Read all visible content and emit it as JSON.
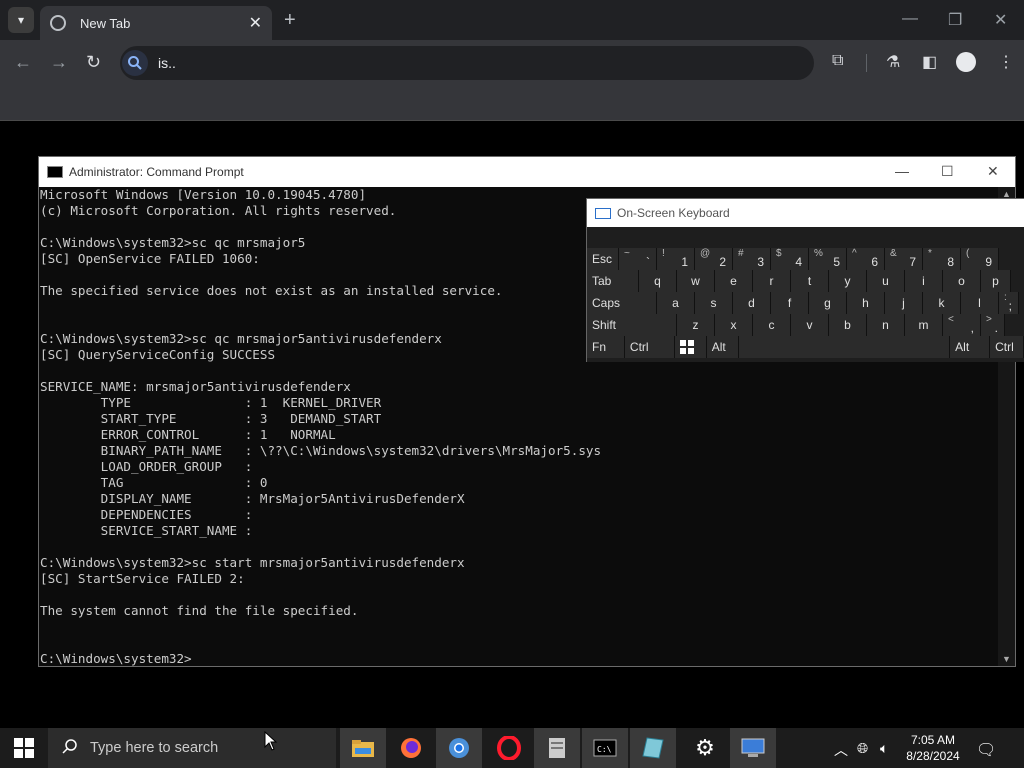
{
  "browser": {
    "tab_title": "New Tab",
    "omnibox_text": "is.."
  },
  "cmd": {
    "title": "Administrator: Command Prompt",
    "lines": [
      "Microsoft Windows [Version 10.0.19045.4780]",
      "(c) Microsoft Corporation. All rights reserved.",
      "",
      "C:\\Windows\\system32>sc qc mrsmajor5",
      "[SC] OpenService FAILED 1060:",
      "",
      "The specified service does not exist as an installed service.",
      "",
      "",
      "C:\\Windows\\system32>sc qc mrsmajor5antivirusdefenderx",
      "[SC] QueryServiceConfig SUCCESS",
      "",
      "SERVICE_NAME: mrsmajor5antivirusdefenderx",
      "        TYPE               : 1  KERNEL_DRIVER",
      "        START_TYPE         : 3   DEMAND_START",
      "        ERROR_CONTROL      : 1   NORMAL",
      "        BINARY_PATH_NAME   : \\??\\C:\\Windows\\system32\\drivers\\MrsMajor5.sys",
      "        LOAD_ORDER_GROUP   :",
      "        TAG                : 0",
      "        DISPLAY_NAME       : MrsMajor5AntivirusDefenderX",
      "        DEPENDENCIES       :",
      "        SERVICE_START_NAME :",
      "",
      "C:\\Windows\\system32>sc start mrsmajor5antivirusdefenderx",
      "[SC] StartService FAILED 2:",
      "",
      "The system cannot find the file specified.",
      "",
      "",
      "C:\\Windows\\system32>"
    ]
  },
  "osk": {
    "title": "On-Screen Keyboard",
    "rows": [
      [
        {
          "label": "Esc",
          "w": 32
        },
        {
          "shift": "~",
          "label": "`",
          "w": 38
        },
        {
          "shift": "!",
          "label": "1",
          "w": 38
        },
        {
          "shift": "@",
          "label": "2",
          "w": 38
        },
        {
          "shift": "#",
          "label": "3",
          "w": 38
        },
        {
          "shift": "$",
          "label": "4",
          "w": 38
        },
        {
          "shift": "%",
          "label": "5",
          "w": 38
        },
        {
          "shift": "^",
          "label": "6",
          "w": 38
        },
        {
          "shift": "&",
          "label": "7",
          "w": 38
        },
        {
          "shift": "*",
          "label": "8",
          "w": 38
        },
        {
          "shift": "(",
          "label": "9",
          "w": 38
        }
      ],
      [
        {
          "label": "Tab",
          "w": 52
        },
        {
          "label": "q",
          "w": 38
        },
        {
          "label": "w",
          "w": 38
        },
        {
          "label": "e",
          "w": 38
        },
        {
          "label": "r",
          "w": 38
        },
        {
          "label": "t",
          "w": 38
        },
        {
          "label": "y",
          "w": 38
        },
        {
          "label": "u",
          "w": 38
        },
        {
          "label": "i",
          "w": 38
        },
        {
          "label": "o",
          "w": 38
        },
        {
          "label": "p",
          "w": 30
        }
      ],
      [
        {
          "label": "Caps",
          "w": 70
        },
        {
          "label": "a",
          "w": 38
        },
        {
          "label": "s",
          "w": 38
        },
        {
          "label": "d",
          "w": 38
        },
        {
          "label": "f",
          "w": 38
        },
        {
          "label": "g",
          "w": 38
        },
        {
          "label": "h",
          "w": 38
        },
        {
          "label": "j",
          "w": 38
        },
        {
          "label": "k",
          "w": 38
        },
        {
          "label": "l",
          "w": 38
        },
        {
          "shift": ":",
          "label": ";",
          "w": 20
        }
      ],
      [
        {
          "label": "Shift",
          "w": 90
        },
        {
          "label": "z",
          "w": 38
        },
        {
          "label": "x",
          "w": 38
        },
        {
          "label": "c",
          "w": 38
        },
        {
          "label": "v",
          "w": 38
        },
        {
          "label": "b",
          "w": 38
        },
        {
          "label": "n",
          "w": 38
        },
        {
          "label": "m",
          "w": 38
        },
        {
          "shift": "<",
          "label": ",",
          "w": 38
        },
        {
          "shift": ">",
          "label": ".",
          "w": 24
        }
      ],
      [
        {
          "label": "Fn",
          "w": 38
        },
        {
          "label": "Ctrl",
          "w": 50
        },
        {
          "label": "win-key",
          "icon": true,
          "w": 32
        },
        {
          "label": "Alt",
          "w": 32
        },
        {
          "label": "",
          "w": 212
        },
        {
          "label": "Alt",
          "w": 40
        },
        {
          "label": "Ctrl",
          "w": 34
        }
      ]
    ]
  },
  "taskbar": {
    "search_placeholder": "Type here to search",
    "time": "7:05 AM",
    "date": "8/28/2024",
    "apps": [
      "file-explorer-icon",
      "firefox-icon",
      "chrome-icon",
      "opera-icon",
      "document-app-icon",
      "cmd-icon",
      "notepad-icon",
      "settings-icon",
      "remote-desktop-icon"
    ]
  }
}
